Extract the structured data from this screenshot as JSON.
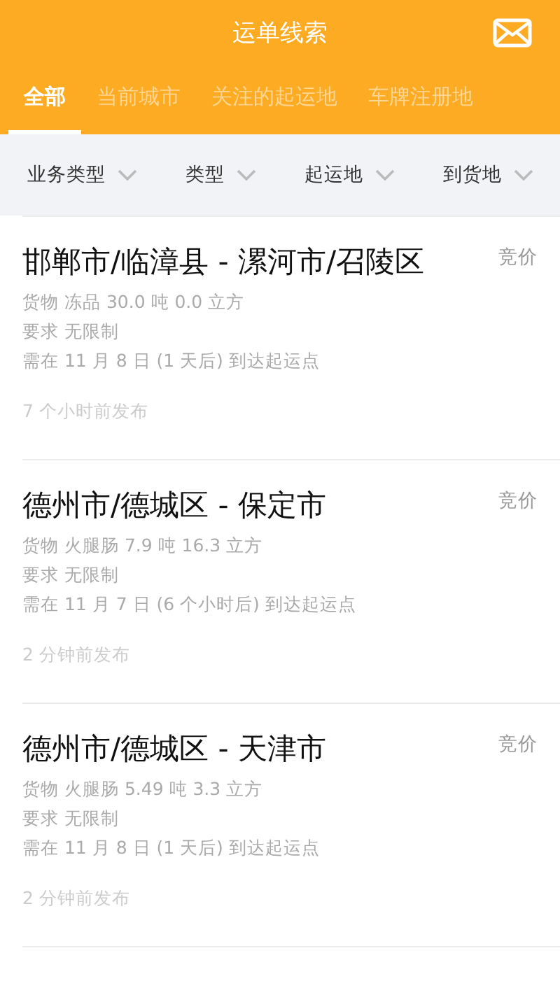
{
  "header": {
    "title": "运单线索"
  },
  "tabs": [
    {
      "label": "全部",
      "selected": true
    },
    {
      "label": "当前城市",
      "selected": false
    },
    {
      "label": "关注的起运地",
      "selected": false
    },
    {
      "label": "车牌注册地",
      "selected": false
    }
  ],
  "filters": [
    "业务类型",
    "类型",
    "起运地",
    "到货地"
  ],
  "orders": [
    {
      "route": "邯郸市/临漳县 - 漯河市/召陵区",
      "price": "竞价",
      "cargo": "货物 冻品 30.0 吨 0.0 立方",
      "requirement": "要求 无限制",
      "arrival": "需在 11 月 8 日 (1 天后) 到达起运点",
      "posted": "7 个小时前发布"
    },
    {
      "route": "德州市/德城区 - 保定市",
      "price": "竞价",
      "cargo": "货物 火腿肠 7.9 吨 16.3 立方",
      "requirement": "要求 无限制",
      "arrival": "需在 11 月 7 日 (6 个小时后) 到达起运点",
      "posted": "2 分钟前发布"
    },
    {
      "route": "德州市/德城区 - 天津市",
      "price": "竞价",
      "cargo": "货物 火腿肠 5.49 吨 3.3 立方",
      "requirement": "要求 无限制",
      "arrival": "需在 11 月 8 日 (1 天后) 到达起运点",
      "posted": "2 分钟前发布"
    }
  ]
}
